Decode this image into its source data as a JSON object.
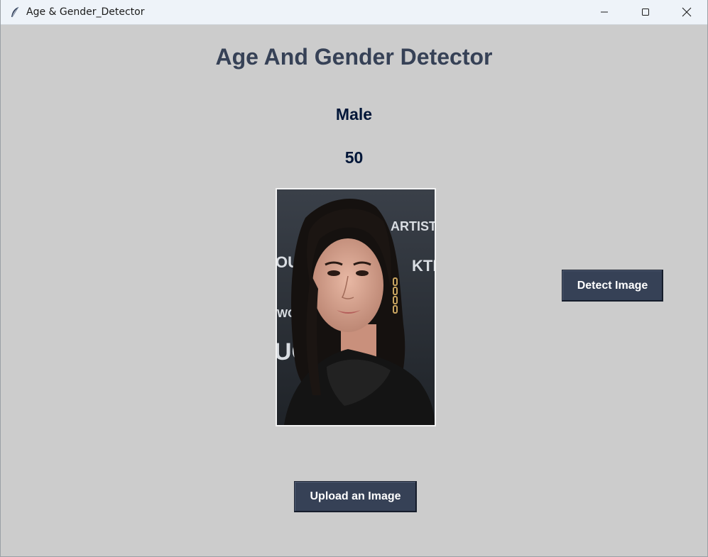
{
  "window": {
    "title": "Age & Gender_Detector",
    "icon": "feather-icon",
    "controls": [
      "minimize-icon",
      "maximize-icon",
      "close-icon"
    ]
  },
  "main": {
    "heading": "Age And Gender Detector",
    "gender_result": "Male",
    "age_result": "50",
    "photo": {
      "image": "portrait-photo",
      "background_signage": [
        "ARTISTS",
        "KTI",
        "OU",
        "WO",
        "UC"
      ]
    },
    "detect_button_label": "Detect Image",
    "upload_button_label": "Upload an Image"
  },
  "colors": {
    "background": "#cccccc",
    "heading": "#364156",
    "result_text": "#011638",
    "button": "#364156",
    "button_text": "#ffffff"
  }
}
